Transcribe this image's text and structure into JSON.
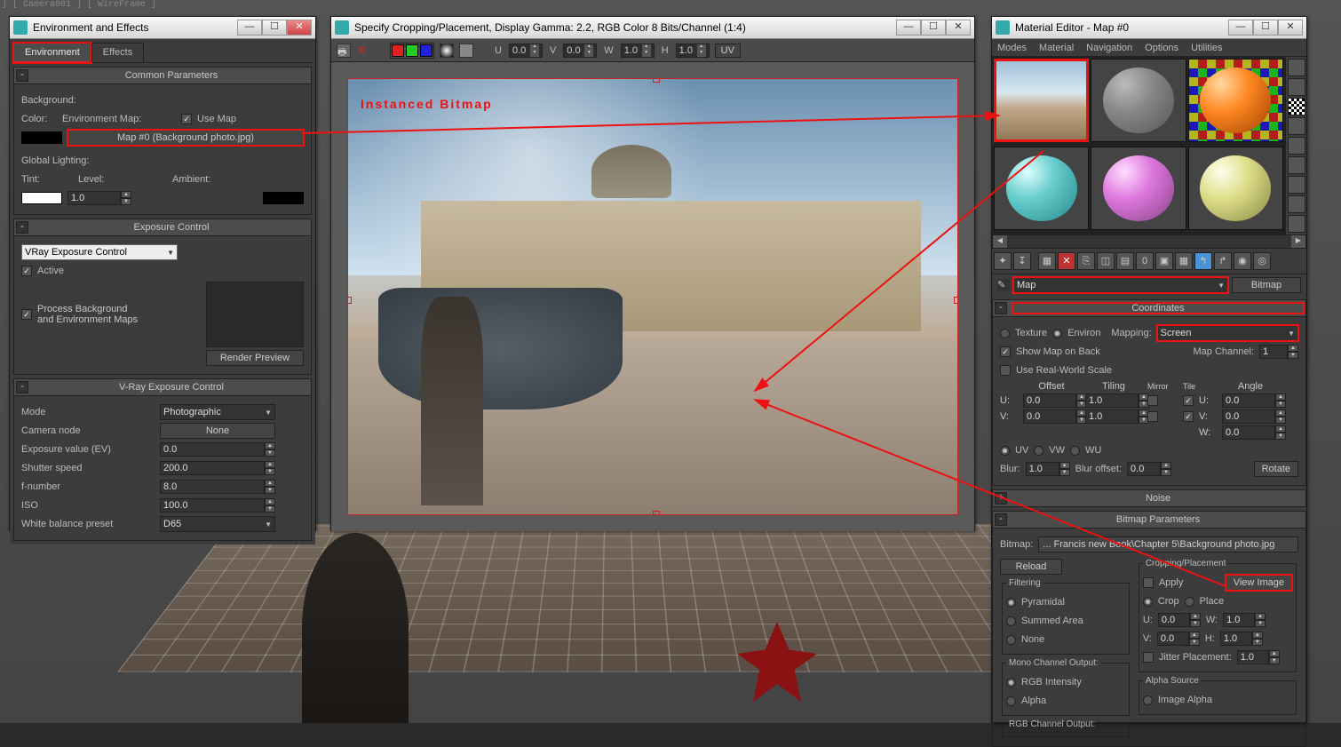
{
  "viewport": {
    "top_label": "] [ Camera001 ] [ WireFrame ]"
  },
  "env_window": {
    "title": "Environment and Effects",
    "tabs": {
      "environment": "Environment",
      "effects": "Effects"
    },
    "common": {
      "header": "Common Parameters",
      "background_label": "Background:",
      "color_label": "Color:",
      "env_map_label": "Environment Map:",
      "use_map_label": "Use Map",
      "map_button": "Map #0 (Background photo.jpg)",
      "global_lighting_label": "Global Lighting:",
      "tint_label": "Tint:",
      "level_label": "Level:",
      "level_value": "1.0",
      "ambient_label": "Ambient:"
    },
    "exposure": {
      "header": "Exposure Control",
      "dropdown_value": "VRay Exposure Control",
      "active_label": "Active",
      "process_bg_label1": "Process Background",
      "process_bg_label2": "and Environment Maps",
      "render_preview_btn": "Render Preview"
    },
    "vray_exposure": {
      "header": "V-Ray Exposure Control",
      "mode_label": "Mode",
      "mode_value": "Photographic",
      "camera_node_label": "Camera node",
      "camera_node_value": "None",
      "ev_label": "Exposure value (EV)",
      "ev_value": "0.0",
      "shutter_label": "Shutter speed",
      "shutter_value": "200.0",
      "fnum_label": "f-number",
      "fnum_value": "8.0",
      "iso_label": "ISO",
      "iso_value": "100.0",
      "wb_label": "White balance preset",
      "wb_value": "D65"
    }
  },
  "crop_window": {
    "title": "Specify Cropping/Placement, Display Gamma: 2.2, RGB Color 8 Bits/Channel (1:4)",
    "toolbar": {
      "u_lbl": "U",
      "u_val": "0.0",
      "v_lbl": "V",
      "v_val": "0.0",
      "w_lbl": "W",
      "w_val": "1.0",
      "h_lbl": "H",
      "h_val": "1.0",
      "uv_btn": "UV"
    },
    "image_label": "Instanced Bitmap"
  },
  "mat_window": {
    "title": "Material Editor - Map #0",
    "menus": {
      "modes": "Modes",
      "material": "Material",
      "navigation": "Navigation",
      "options": "Options",
      "utilities": "Utilities"
    },
    "name_dropdown": "Map",
    "type_button": "Bitmap",
    "coords": {
      "header": "Coordinates",
      "texture_label": "Texture",
      "environ_label": "Environ",
      "mapping_label": "Mapping:",
      "mapping_value": "Screen",
      "show_map_label": "Show Map on Back",
      "map_channel_label": "Map Channel:",
      "map_channel_value": "1",
      "real_world_label": "Use Real-World Scale",
      "hdr_offset": "Offset",
      "hdr_tiling": "Tiling",
      "hdr_mirror": "Mirror",
      "hdr_tile": "Tile",
      "hdr_angle": "Angle",
      "u_lbl": "U:",
      "u_off": "0.0",
      "u_til": "1.0",
      "u_ang": "0.0",
      "v_lbl": "V:",
      "v_off": "0.0",
      "v_til": "1.0",
      "v_ang": "0.0",
      "w_lbl": "W:",
      "w_ang": "0.0",
      "uv_label": "UV",
      "vw_label": "VW",
      "wu_label": "WU",
      "blur_label": "Blur:",
      "blur_val": "1.0",
      "blur_off_label": "Blur offset:",
      "blur_off_val": "0.0",
      "rotate_btn": "Rotate"
    },
    "noise": {
      "header": "Noise"
    },
    "bitmap_params": {
      "header": "Bitmap Parameters",
      "bitmap_label": "Bitmap:",
      "bitmap_path": "... Francis new Book\\Chapter 5\\Background photo.jpg",
      "reload_btn": "Reload",
      "crop_group": "Cropping/Placement",
      "apply_label": "Apply",
      "view_image_btn": "View Image",
      "crop_label": "Crop",
      "place_label": "Place",
      "cu_lbl": "U:",
      "cu_val": "0.0",
      "cw_lbl": "W:",
      "cw_val": "1.0",
      "cv_lbl": "V:",
      "cv_val": "0.0",
      "ch_lbl": "H:",
      "ch_val": "1.0",
      "jitter_label": "Jitter Placement:",
      "jitter_val": "1.0",
      "filtering_group": "Filtering",
      "filt_pyr": "Pyramidal",
      "filt_sum": "Summed Area",
      "filt_none": "None",
      "mono_group": "Mono Channel Output:",
      "mono_rgb": "RGB Intensity",
      "mono_alpha": "Alpha",
      "rgb_group": "RGB Channel Output:",
      "alpha_group": "Alpha Source",
      "alpha_img": "Image Alpha"
    }
  }
}
